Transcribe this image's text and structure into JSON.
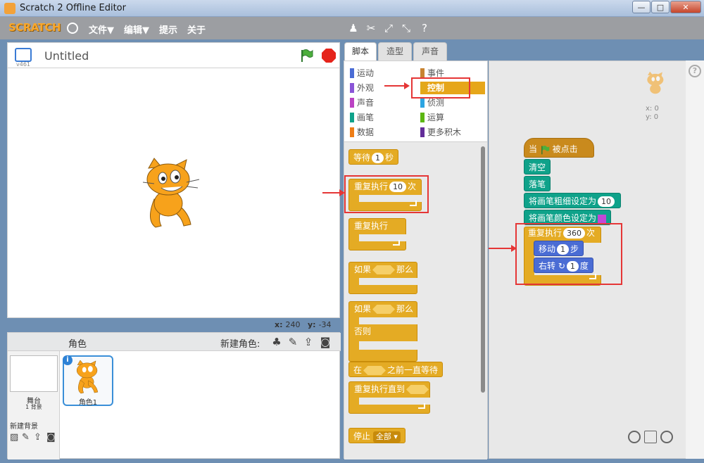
{
  "window": {
    "title": "Scratch 2 Offline Editor"
  },
  "menubar": {
    "logo": "SCRATCH",
    "file": "文件▼",
    "edit": "编辑▼",
    "tips": "提示",
    "about": "关于"
  },
  "stage": {
    "version": "v461",
    "project_title": "Untitled",
    "mouse_x_label": "x:",
    "mouse_x": "240",
    "mouse_y_label": "y:",
    "mouse_y": "-34"
  },
  "sprites": {
    "header": "角色",
    "new_sprite": "新建角色:",
    "stage_name": "舞台",
    "backdrop_count": "1 背景",
    "new_backdrop": "新建背景",
    "sprite_1": "角色1"
  },
  "tabs": [
    "脚本",
    "造型",
    "声音"
  ],
  "categories": {
    "motion": "运动",
    "looks": "外观",
    "sound": "声音",
    "pen": "画笔",
    "data": "数据",
    "events": "事件",
    "control": "控制",
    "sensing": "侦测",
    "operators": "运算",
    "more": "更多积木"
  },
  "palette_blocks": {
    "wait": "等待",
    "wait_val": "1",
    "wait_unit": "秒",
    "repeat": "重复执行",
    "repeat_val": "10",
    "repeat_unit": "次",
    "forever": "重复执行",
    "if": "如果",
    "then": "那么",
    "if2": "如果",
    "then2": "那么",
    "else": "否则",
    "wait_until_pre": "在",
    "wait_until_post": "之前一直等待",
    "repeat_until": "重复执行直到",
    "stop": "停止",
    "stop_opt": "全部"
  },
  "script": {
    "when": "当",
    "clicked": "被点击",
    "clear": "清空",
    "pen_down": "落笔",
    "set_size": "将画笔粗细设定为",
    "size_val": "10",
    "set_color": "将画笔颜色设定为",
    "repeat": "重复执行",
    "repeat_val": "360",
    "repeat_unit": "次",
    "move": "移动",
    "move_val": "1",
    "move_unit": "步",
    "turn": "右转",
    "turn_val": "1",
    "turn_unit": "度"
  },
  "sprite_info": {
    "x": "x: 0",
    "y": "y: 0"
  },
  "colors": {
    "motion": "#4a6cd4",
    "looks": "#8a55d7",
    "sound": "#bb42c3",
    "pen": "#0fa28a",
    "data": "#ee7d16",
    "events": "#c88330",
    "control": "#e1a91a",
    "sensing": "#2ca5e2",
    "operators": "#5cb712",
    "more": "#632d99"
  }
}
